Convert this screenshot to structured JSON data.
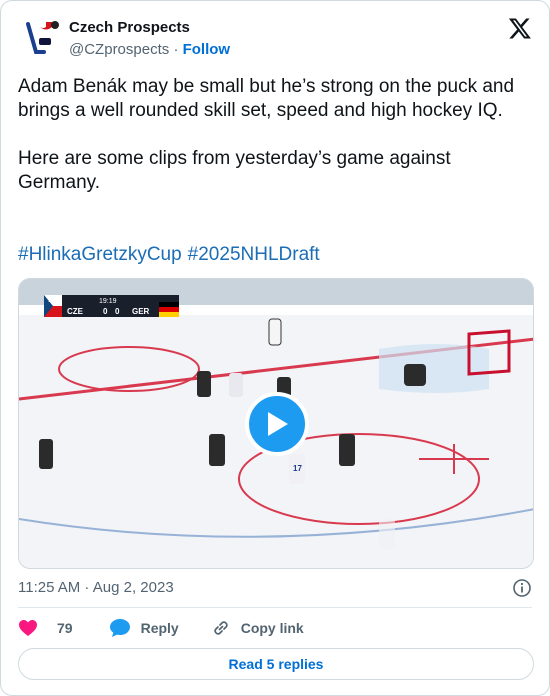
{
  "author": {
    "display_name": "Czech Prospects",
    "handle": "@CZprospects",
    "separator": "·",
    "follow_label": "Follow"
  },
  "tweet": {
    "text": "Adam Benák may be small but he’s strong on the puck and brings a well rounded skill set, speed and high hockey IQ.\n\nHere are some clips from yesterday’s game against Germany.",
    "hashtags": [
      "#HlinkaGretzkyCup",
      "#2025NHLDraft"
    ]
  },
  "video": {
    "scorebug": {
      "period": "1st",
      "clock": "19:19",
      "home_team": "CZE",
      "home_score": "0",
      "away_score": "0",
      "away_team": "GER"
    },
    "player_number": "17"
  },
  "meta": {
    "timestamp": "11:25 AM · Aug 2, 2023"
  },
  "actions": {
    "likes": "79",
    "reply_label": "Reply",
    "copy_link_label": "Copy link"
  },
  "footer": {
    "read_replies_label": "Read 5 replies"
  },
  "colors": {
    "link": "#006fd6",
    "play_button": "#1d9bf0",
    "like_heart": "#f91880",
    "reply_bubble": "#1d9bf0"
  },
  "icons": [
    "team-avatar-icon",
    "x-logo-icon",
    "play-icon",
    "info-icon",
    "heart-icon",
    "reply-icon",
    "link-icon"
  ]
}
